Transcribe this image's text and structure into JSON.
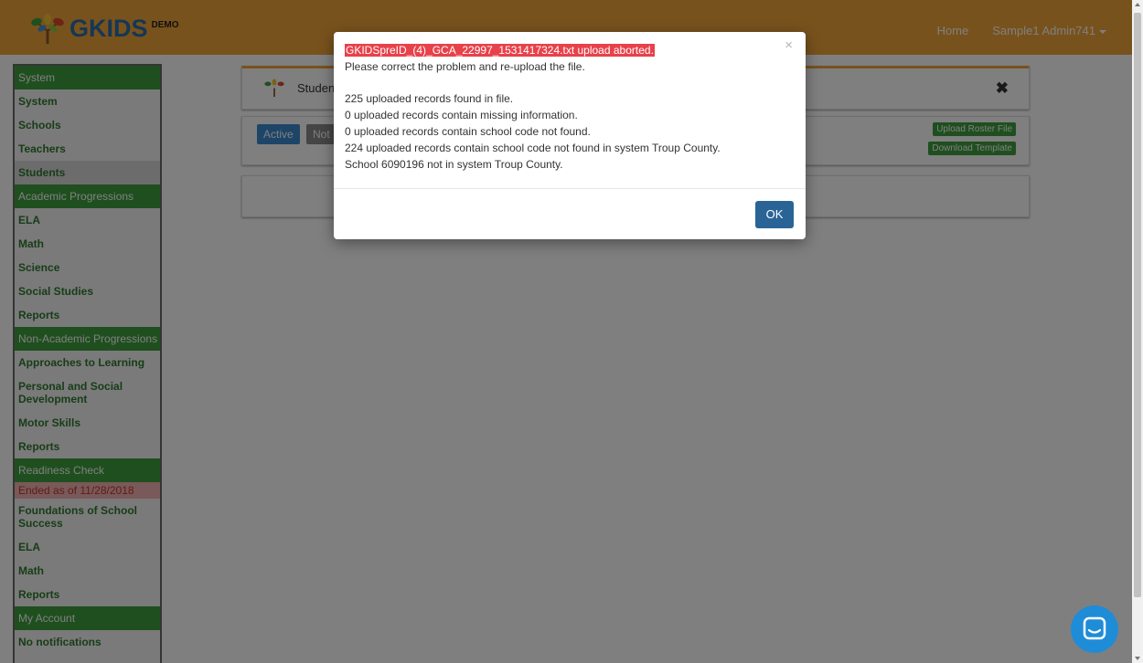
{
  "header": {
    "logo_text": "GKIDS",
    "logo_badge": "DEMO",
    "nav_home": "Home",
    "user_menu": "Sample1 Admin741"
  },
  "sidebar": {
    "sections": [
      {
        "header": "System",
        "items": [
          "System",
          "Schools",
          "Teachers",
          "Students"
        ]
      },
      {
        "header": "Academic Progressions",
        "items": [
          "ELA",
          "Math",
          "Science",
          "Social Studies",
          "Reports"
        ]
      },
      {
        "header": "Non-Academic Progressions",
        "items": [
          "Approaches to Learning",
          "Personal and Social Development",
          "Motor Skills",
          "Reports"
        ]
      },
      {
        "header": "Readiness Check",
        "ended": "Ended as of 11/28/2018",
        "items": [
          "Foundations of School Success",
          "ELA",
          "Math",
          "Reports"
        ]
      },
      {
        "header": "My Account",
        "items": [
          "No notifications"
        ]
      }
    ]
  },
  "main": {
    "panel_title": "Studen",
    "filter_active": "Active",
    "filter_not": "Not",
    "upload_button": "Upload Roster File",
    "template_button": "Download Template"
  },
  "modal": {
    "title": "GKIDSpreID_(4)_GCA_22997_1531417324.txt upload aborted.",
    "line1": "Please correct the problem and re-upload the file.",
    "line2": "225 uploaded records found in file.",
    "line3": "0 uploaded records contain missing information.",
    "line4": "0 uploaded records contain school code not found.",
    "line5": "224 uploaded records contain school code not found in system Troup County.",
    "line6": "School 6090196 not in system Troup County.",
    "ok_label": "OK",
    "close_glyph": "×"
  },
  "colors": {
    "navbar": "#f0a53a",
    "sidebar_header": "#3f9e3f",
    "modal_title_bg": "#e8414a",
    "ok_button": "#2a6496"
  },
  "icons": [
    "tree-logo-icon",
    "close-icon",
    "caret-down-icon",
    "chat-icon"
  ]
}
